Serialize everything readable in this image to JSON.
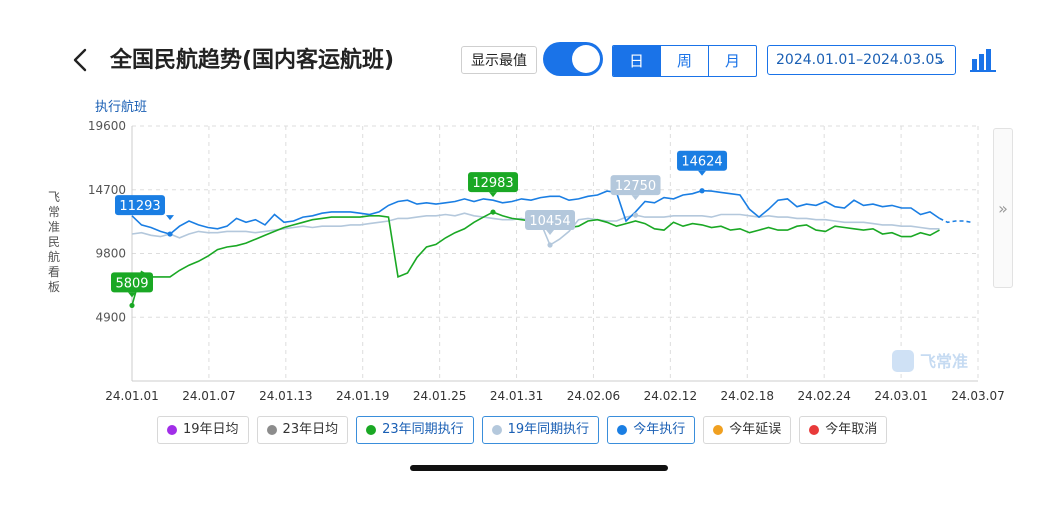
{
  "header": {
    "title": "全国民航趋势(国内客运航班)",
    "toggle_label": "显示最值",
    "period_tabs": [
      "日",
      "周",
      "月"
    ],
    "active_period": "日",
    "date_range": "2024.01.01–2024.03.05",
    "date_chevron": "⌄"
  },
  "side_title": "飞常准民航看板",
  "next_arrow": "»",
  "watermark": "飞常准",
  "chart_data": {
    "type": "line",
    "ylabel": "执行航班",
    "ylim": [
      0,
      19600
    ],
    "yticks": [
      4900,
      9800,
      14700,
      19600
    ],
    "ytick_labels": [
      "4900",
      "9800",
      "14700",
      "19600"
    ],
    "xtick_labels": [
      "24.01.01",
      "24.01.07",
      "24.01.13",
      "24.01.19",
      "24.01.25",
      "24.01.31",
      "24.02.06",
      "24.02.12",
      "24.02.18",
      "24.02.24",
      "24.03.01",
      "24.03.07"
    ],
    "grid": true,
    "series": [
      {
        "name": "今年执行",
        "color": "#1a7ee3",
        "values": [
          12700,
          12000,
          11800,
          11500,
          11293,
          11900,
          12300,
          12000,
          11800,
          11700,
          11900,
          12500,
          12200,
          12400,
          12000,
          12800,
          12200,
          12300,
          12600,
          12700,
          12900,
          13000,
          13000,
          13000,
          12900,
          12800,
          13000,
          13500,
          13800,
          13900,
          13600,
          13700,
          13600,
          13700,
          13800,
          14000,
          13800,
          14000,
          13900,
          13700,
          13800,
          14000,
          13900,
          14100,
          14200,
          14200,
          13900,
          14000,
          14200,
          14300,
          14600,
          14500,
          12300,
          13000,
          13800,
          13700,
          14100,
          14000,
          14300,
          14400,
          14624,
          14600,
          14500,
          14400,
          14300,
          13200,
          12600,
          13200,
          13900,
          14000,
          13400,
          13600,
          13500,
          13800,
          13400,
          13300,
          13900,
          13500,
          13600,
          13400,
          13500,
          13300,
          13300,
          12800,
          13000,
          12500
        ],
        "forecast": [
          12500,
          12200,
          12300,
          12300,
          12200
        ]
      },
      {
        "name": "23年同期执行",
        "color": "#1aa824",
        "values": [
          5809,
          8400,
          8000,
          8000,
          8000,
          8500,
          8900,
          9200,
          9600,
          10100,
          10300,
          10400,
          10600,
          10900,
          11200,
          11500,
          11800,
          12000,
          12200,
          12400,
          12500,
          12600,
          12600,
          12600,
          12600,
          12700,
          12700,
          12600,
          8000,
          8300,
          9500,
          10300,
          10500,
          11000,
          11400,
          11700,
          12200,
          12600,
          12983,
          12700,
          12500,
          12400,
          12300,
          12300,
          12200,
          12100,
          11800,
          11900,
          12300,
          12400,
          12200,
          11900,
          12100,
          12300,
          12100,
          11700,
          11600,
          12200,
          11900,
          12100,
          12000,
          11800,
          11900,
          11600,
          11700,
          11400,
          11600,
          11800,
          11600,
          11600,
          11900,
          12000,
          11600,
          11500,
          11900,
          11800,
          11700,
          11600,
          11700,
          11300,
          11400,
          11100,
          11100,
          11400,
          11200,
          11600
        ]
      },
      {
        "name": "19年同期执行",
        "color": "#b4c8dc",
        "values": [
          11300,
          11400,
          11200,
          11100,
          11300,
          11000,
          11300,
          11500,
          11400,
          11400,
          11500,
          11500,
          11500,
          11400,
          11500,
          11600,
          11700,
          11800,
          11900,
          11800,
          11900,
          11900,
          11900,
          12000,
          12000,
          12100,
          12200,
          12300,
          12500,
          12500,
          12600,
          12700,
          12700,
          12800,
          12700,
          12900,
          12700,
          12600,
          12500,
          12400,
          12400,
          12500,
          12300,
          12200,
          10454,
          10900,
          11500,
          12400,
          12500,
          12400,
          12300,
          12300,
          12600,
          12750,
          12600,
          12600,
          12600,
          12700,
          12700,
          12700,
          12700,
          12600,
          12800,
          12800,
          12800,
          12700,
          12600,
          12700,
          12600,
          12600,
          12500,
          12500,
          12400,
          12400,
          12300,
          12200,
          12200,
          12200,
          12100,
          12000,
          12000,
          11900,
          11900,
          11800,
          11700,
          11700
        ]
      }
    ],
    "annotations": [
      {
        "series": "今年执行",
        "index": 4,
        "label": "11293"
      },
      {
        "series": "今年执行",
        "index": 60,
        "label": "14624"
      },
      {
        "series": "23年同期执行",
        "index": 0,
        "label": "5809"
      },
      {
        "series": "23年同期执行",
        "index": 38,
        "label": "12983"
      },
      {
        "series": "19年同期执行",
        "index": 44,
        "label": "10454"
      },
      {
        "series": "19年同期执行",
        "index": 53,
        "label": "12750"
      }
    ],
    "legend": [
      {
        "label": "19年日均",
        "color": "#a12ee8",
        "active": false
      },
      {
        "label": "23年日均",
        "color": "#8c8c8c",
        "active": false
      },
      {
        "label": "23年同期执行",
        "color": "#1aa824",
        "active": true
      },
      {
        "label": "19年同期执行",
        "color": "#b4c8dc",
        "active": true
      },
      {
        "label": "今年执行",
        "color": "#1a7ee3",
        "active": true
      },
      {
        "label": "今年延误",
        "color": "#f0a020",
        "active": false
      },
      {
        "label": "今年取消",
        "color": "#e83a3a",
        "active": false
      }
    ],
    "legend_position": "bottom"
  }
}
